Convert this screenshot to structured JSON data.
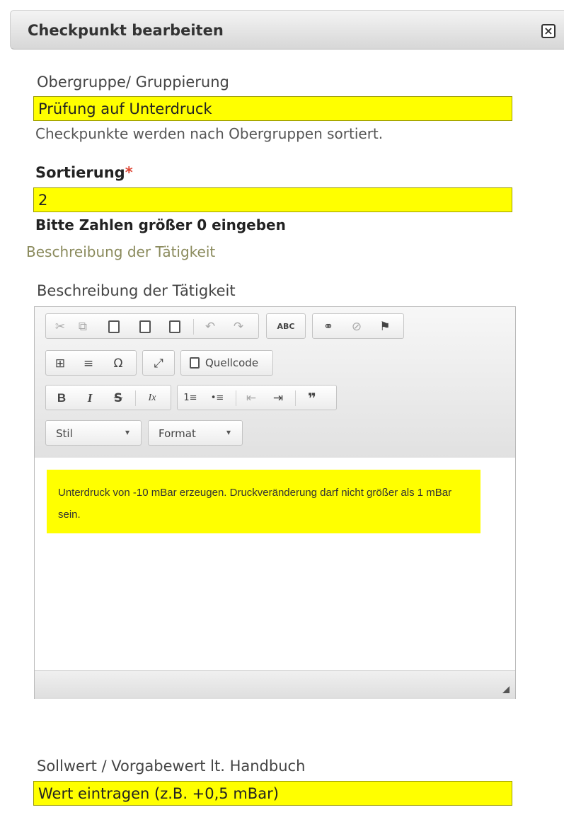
{
  "dialog": {
    "title": "Checkpunkt bearbeiten",
    "close_label": "×"
  },
  "obergruppe": {
    "label": "Obergruppe/ Gruppierung",
    "value": "Prüfung auf Unterdruck",
    "hint": "Checkpunkte werden nach Obergruppen sortiert."
  },
  "sortierung": {
    "label": "Sortierung",
    "required_mark": "*",
    "value": "2",
    "hint": "Bitte Zahlen größer 0 eingeben"
  },
  "section_heading": "Beschreibung der Tätigkeit",
  "beschreibung": {
    "label": "Beschreibung der Tätigkeit",
    "toolbar": {
      "cut_icon": "✂",
      "copy_icon": "⧉",
      "paste_icon": "📋",
      "undo_icon": "↶",
      "redo_icon": "↷",
      "spellcheck_icon": "ABC",
      "link_icon": "⚭",
      "unlink_icon": "⊘",
      "anchor_icon": "⚑",
      "table_icon": "⊞",
      "hr_icon": "≡",
      "special_char_icon": "Ω",
      "maximize_icon": "⤢",
      "source_label": "Quellcode",
      "bold_label": "B",
      "italic_label": "I",
      "strike_label": "S",
      "remove_format_label": "Ix",
      "numbered_list_icon": "1≡",
      "bullet_list_icon": "•≡",
      "outdent_icon": "⇤",
      "indent_icon": "⇥",
      "blockquote_icon": "❞",
      "style_label": "Stil",
      "format_label": "Format"
    },
    "content": "Unterdruck von -10 mBar erzeugen. Druckveränderung darf nicht größer als 1 mBar sein."
  },
  "sollwert": {
    "label": "Sollwert / Vorgabewert lt. Handbuch",
    "value": "Wert eintragen (z.B. +0,5 mBar)"
  }
}
